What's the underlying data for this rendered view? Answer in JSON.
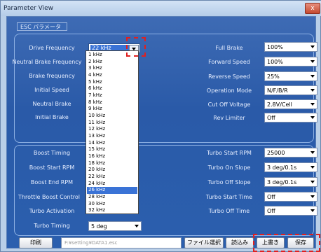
{
  "window": {
    "title": "Parameter View",
    "close_label": "x"
  },
  "tab": {
    "label": "ESC パラメータ"
  },
  "left_top": [
    {
      "label": "Drive Frequency",
      "value": "22 kHz"
    },
    {
      "label": "Neutral Brake Frequency",
      "value": ""
    },
    {
      "label": "Brake frequency",
      "value": ""
    },
    {
      "label": "Initial Speed",
      "value": ""
    },
    {
      "label": "Neutral Brake",
      "value": ""
    },
    {
      "label": "Initial Brake",
      "value": ""
    }
  ],
  "right_top": [
    {
      "label": "Full Brake",
      "value": "100%"
    },
    {
      "label": "Forward Speed",
      "value": "100%"
    },
    {
      "label": "Reverse Speed",
      "value": "25%"
    },
    {
      "label": "Operation Mode",
      "value": "N/F/B/R"
    },
    {
      "label": "Cut Off Voltage",
      "value": "2.8V/Cell"
    },
    {
      "label": "Rev Limiter",
      "value": "Off"
    }
  ],
  "left_bottom": [
    {
      "label": "Boost Timing",
      "value": ""
    },
    {
      "label": "Boost Start RPM",
      "value": ""
    },
    {
      "label": "Boost End RPM",
      "value": ""
    },
    {
      "label": "Throttle Boost Control",
      "value": ""
    },
    {
      "label": "Turbo Activation",
      "value": ""
    },
    {
      "label": "Turbo Timing",
      "value": "5 deg"
    }
  ],
  "right_bottom": [
    {
      "label": "Turbo Start RPM",
      "value": "25000"
    },
    {
      "label": "Turbo On Slope",
      "value": "3 deg/0.1s"
    },
    {
      "label": "Turbo Off Slope",
      "value": "3 deg/0.1s"
    },
    {
      "label": "Turbo Start Time",
      "value": "Off"
    },
    {
      "label": "Turbo Off Time",
      "value": "Off"
    }
  ],
  "dropdown": {
    "selected": "26 kHz",
    "options": [
      "1 kHz",
      "2 kHz",
      "3 kHz",
      "4 kHz",
      "5 kHz",
      "6 kHz",
      "7 kHz",
      "8 kHz",
      "9 kHz",
      "10 kHz",
      "11 kHz",
      "12 kHz",
      "13 kHz",
      "14 kHz",
      "15 kHz",
      "16 kHz",
      "18 kHz",
      "20 kHz",
      "22 kHz",
      "24 kHz",
      "26 kHz",
      "28 kHz",
      "30 kHz",
      "32 kHz"
    ]
  },
  "bottom": {
    "print_label": "印刷",
    "path_value": "F:¥setting¥DATA1.esc",
    "select_file_label": "ファイル選択",
    "load_label": "読込み",
    "overwrite_label": "上書き",
    "save_label": "保存"
  },
  "colors": {
    "highlight": "#e02020",
    "selection": "#3a73d6"
  }
}
